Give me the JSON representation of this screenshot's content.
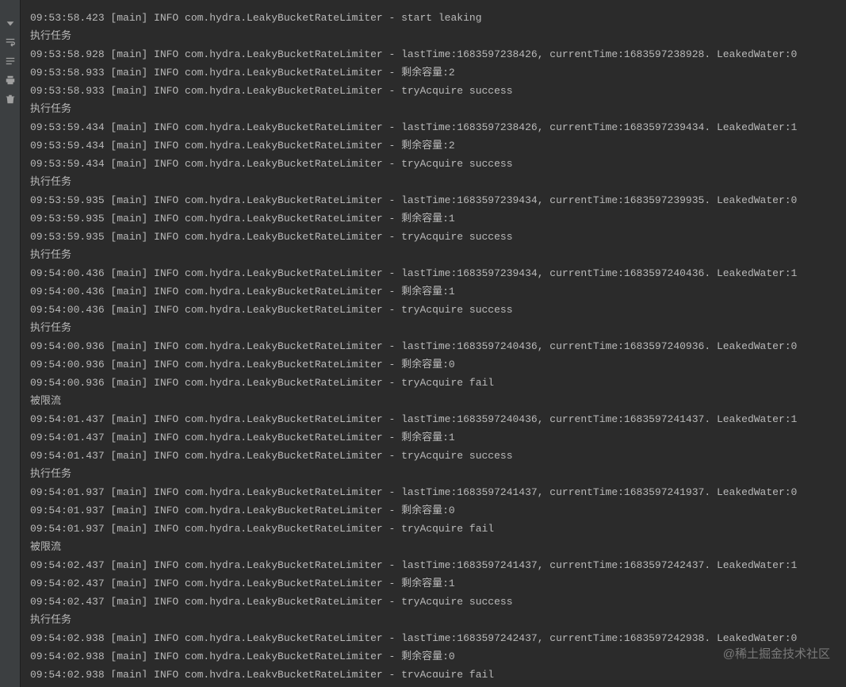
{
  "toolbar": {
    "icons": [
      "arrow-down-icon",
      "wrap-icon",
      "scroll-icon",
      "print-icon",
      "trash-icon"
    ]
  },
  "watermark": "@稀土掘金技术社区",
  "lines": [
    "09:53:58.423 [main] INFO com.hydra.LeakyBucketRateLimiter - start leaking",
    "执行任务",
    "09:53:58.928 [main] INFO com.hydra.LeakyBucketRateLimiter - lastTime:1683597238426, currentTime:1683597238928. LeakedWater:0",
    "09:53:58.933 [main] INFO com.hydra.LeakyBucketRateLimiter - 剩余容量:2",
    "09:53:58.933 [main] INFO com.hydra.LeakyBucketRateLimiter - tryAcquire success",
    "执行任务",
    "09:53:59.434 [main] INFO com.hydra.LeakyBucketRateLimiter - lastTime:1683597238426, currentTime:1683597239434. LeakedWater:1",
    "09:53:59.434 [main] INFO com.hydra.LeakyBucketRateLimiter - 剩余容量:2",
    "09:53:59.434 [main] INFO com.hydra.LeakyBucketRateLimiter - tryAcquire success",
    "执行任务",
    "09:53:59.935 [main] INFO com.hydra.LeakyBucketRateLimiter - lastTime:1683597239434, currentTime:1683597239935. LeakedWater:0",
    "09:53:59.935 [main] INFO com.hydra.LeakyBucketRateLimiter - 剩余容量:1",
    "09:53:59.935 [main] INFO com.hydra.LeakyBucketRateLimiter - tryAcquire success",
    "执行任务",
    "09:54:00.436 [main] INFO com.hydra.LeakyBucketRateLimiter - lastTime:1683597239434, currentTime:1683597240436. LeakedWater:1",
    "09:54:00.436 [main] INFO com.hydra.LeakyBucketRateLimiter - 剩余容量:1",
    "09:54:00.436 [main] INFO com.hydra.LeakyBucketRateLimiter - tryAcquire success",
    "执行任务",
    "09:54:00.936 [main] INFO com.hydra.LeakyBucketRateLimiter - lastTime:1683597240436, currentTime:1683597240936. LeakedWater:0",
    "09:54:00.936 [main] INFO com.hydra.LeakyBucketRateLimiter - 剩余容量:0",
    "09:54:00.936 [main] INFO com.hydra.LeakyBucketRateLimiter - tryAcquire fail",
    "被限流",
    "09:54:01.437 [main] INFO com.hydra.LeakyBucketRateLimiter - lastTime:1683597240436, currentTime:1683597241437. LeakedWater:1",
    "09:54:01.437 [main] INFO com.hydra.LeakyBucketRateLimiter - 剩余容量:1",
    "09:54:01.437 [main] INFO com.hydra.LeakyBucketRateLimiter - tryAcquire success",
    "执行任务",
    "09:54:01.937 [main] INFO com.hydra.LeakyBucketRateLimiter - lastTime:1683597241437, currentTime:1683597241937. LeakedWater:0",
    "09:54:01.937 [main] INFO com.hydra.LeakyBucketRateLimiter - 剩余容量:0",
    "09:54:01.937 [main] INFO com.hydra.LeakyBucketRateLimiter - tryAcquire fail",
    "被限流",
    "09:54:02.437 [main] INFO com.hydra.LeakyBucketRateLimiter - lastTime:1683597241437, currentTime:1683597242437. LeakedWater:1",
    "09:54:02.437 [main] INFO com.hydra.LeakyBucketRateLimiter - 剩余容量:1",
    "09:54:02.437 [main] INFO com.hydra.LeakyBucketRateLimiter - tryAcquire success",
    "执行任务",
    "09:54:02.938 [main] INFO com.hydra.LeakyBucketRateLimiter - lastTime:1683597242437, currentTime:1683597242938. LeakedWater:0",
    "09:54:02.938 [main] INFO com.hydra.LeakyBucketRateLimiter - 剩余容量:0",
    "09:54:02.938 [main] INFO com.hydra.LeakyBucketRateLimiter - tryAcquire fail"
  ]
}
